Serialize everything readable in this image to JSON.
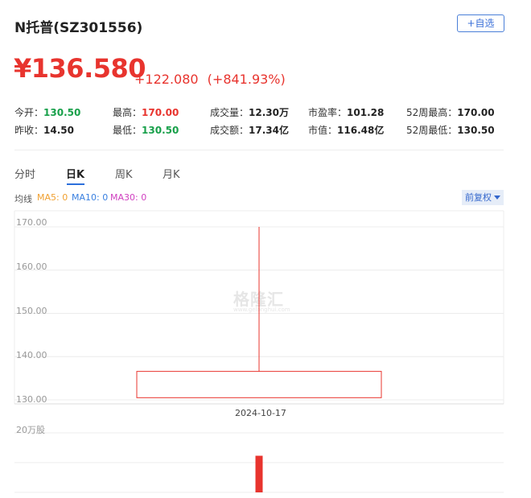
{
  "header": {
    "title": "N托普(SZ301556)",
    "watchlist_label": "+自选"
  },
  "quote": {
    "price": "¥136.580",
    "change": "+122.080",
    "change_pct": "(+841.93%)"
  },
  "stats": {
    "open_label": "今开：",
    "open_value": "130.50",
    "high_label": "最高：",
    "high_value": "170.00",
    "volume_label": "成交量：",
    "volume_value": "12.30万",
    "pe_label": "市盈率：",
    "pe_value": "101.28",
    "w52high_label": "52周最高：",
    "w52high_value": "170.00",
    "prevclose_label": "昨收：",
    "prevclose_value": "14.50",
    "low_label": "最低：",
    "low_value": "130.50",
    "turnover_label": "成交额：",
    "turnover_value": "17.34亿",
    "mktcap_label": "市值：",
    "mktcap_value": "116.48亿",
    "w52low_label": "52周最低：",
    "w52low_value": "130.50"
  },
  "tabs": [
    "分时",
    "日K",
    "周K",
    "月K"
  ],
  "ma": {
    "label": "均线",
    "ma5": "MA5: 0",
    "ma10": "MA10: 0",
    "ma30": "MA30: 0",
    "ma5_color": "#f0a030",
    "ma10_color": "#3a80e0",
    "ma30_color": "#d040c0"
  },
  "adjust_label": "前复权",
  "watermark": "格隆汇",
  "watermark_url": "www.gelonghui.com",
  "colors": {
    "up": "#e8342e",
    "down": "#18a04a",
    "accent": "#2c6fdb"
  },
  "chart_data": [
    {
      "type": "candlestick",
      "x": [
        "2024-10-17"
      ],
      "open": [
        130.5
      ],
      "high": [
        170.0
      ],
      "low": [
        130.5
      ],
      "close": [
        136.58
      ],
      "ylim": [
        130,
        170
      ],
      "yticks": [
        "170.00",
        "160.00",
        "150.00",
        "140.00",
        "130.00"
      ],
      "grid": true
    },
    {
      "type": "bar",
      "categories": [
        "2024-10-17"
      ],
      "values": [
        12.3
      ],
      "unit_label": "20万股",
      "ylim": [
        0,
        20
      ]
    }
  ]
}
